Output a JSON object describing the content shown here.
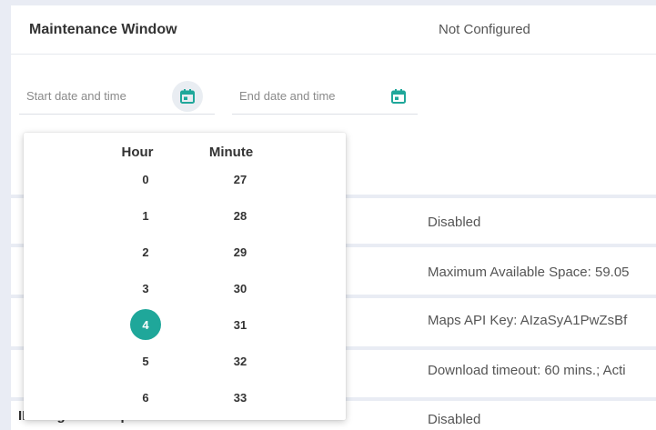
{
  "maintenance": {
    "title": "Maintenance Window",
    "value": "Not Configured"
  },
  "start": {
    "placeholder": "Start date and time"
  },
  "end": {
    "placeholder": "End date and time"
  },
  "accent_color": "#1fa79a",
  "icons": {
    "calendar": "calendar-icon"
  },
  "rows": [
    {
      "value": "Disabled"
    },
    {
      "value": "Maximum Available Space: 59.05"
    },
    {
      "value": "Maps API Key: AIzaSyA1PwZsBf"
    },
    {
      "value": "Download timeout: 60 mins.; Acti"
    },
    {
      "label": "IPS Signature Update",
      "value": "Disabled"
    }
  ],
  "picker": {
    "hour_header": "Hour",
    "minute_header": "Minute",
    "hours": [
      "0",
      "1",
      "2",
      "3",
      "4",
      "5",
      "6"
    ],
    "minutes": [
      "27",
      "28",
      "29",
      "30",
      "31",
      "32",
      "33"
    ],
    "selected_hour": "4"
  }
}
